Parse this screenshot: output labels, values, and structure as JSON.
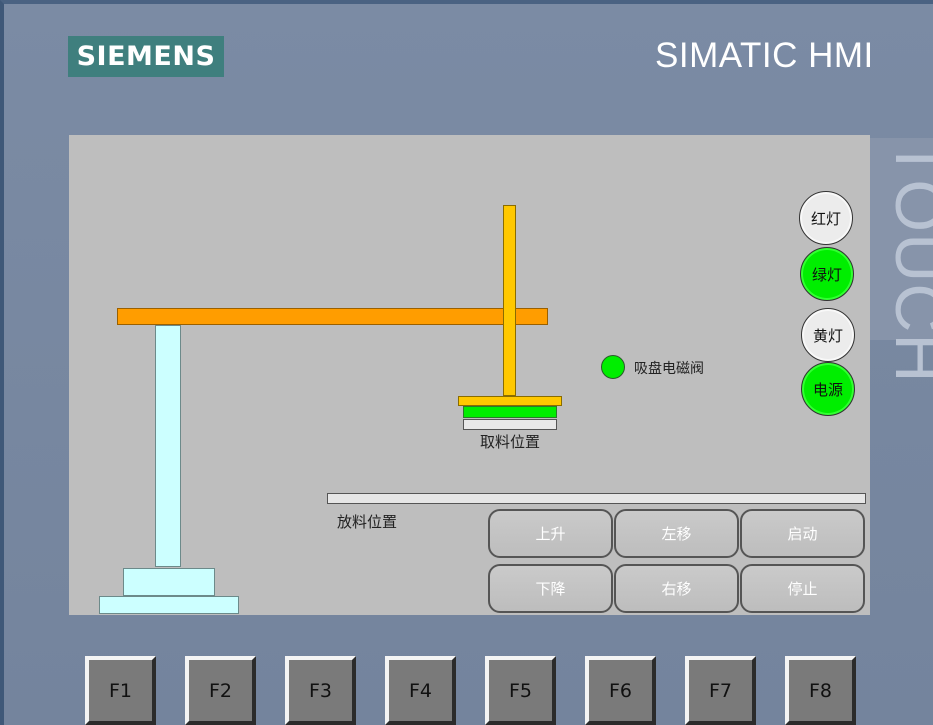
{
  "panel": {
    "logo": "SIEMENS",
    "brand": "SIMATIC HMI",
    "side_label": "TOUCH"
  },
  "screen": {
    "pick_position_label": "取料位置",
    "place_position_label": "放料位置",
    "valve_label": "吸盘电磁阀",
    "valve_state": "on",
    "indicators": [
      {
        "label": "红灯",
        "state": "off"
      },
      {
        "label": "绿灯",
        "state": "on"
      },
      {
        "label": "黄灯",
        "state": "off"
      },
      {
        "label": "电源",
        "state": "on"
      }
    ],
    "buttons": {
      "up": "上升",
      "left": "左移",
      "start": "启动",
      "down": "下降",
      "right": "右移",
      "stop": "停止"
    },
    "colors": {
      "lamp_on": "#00ee00",
      "lamp_off": "#ececec",
      "beam": "#ff9d00",
      "rod": "#ffc800",
      "column": "#ccffff"
    }
  },
  "function_keys": [
    "F1",
    "F2",
    "F3",
    "F4",
    "F5",
    "F6",
    "F7",
    "F8"
  ]
}
